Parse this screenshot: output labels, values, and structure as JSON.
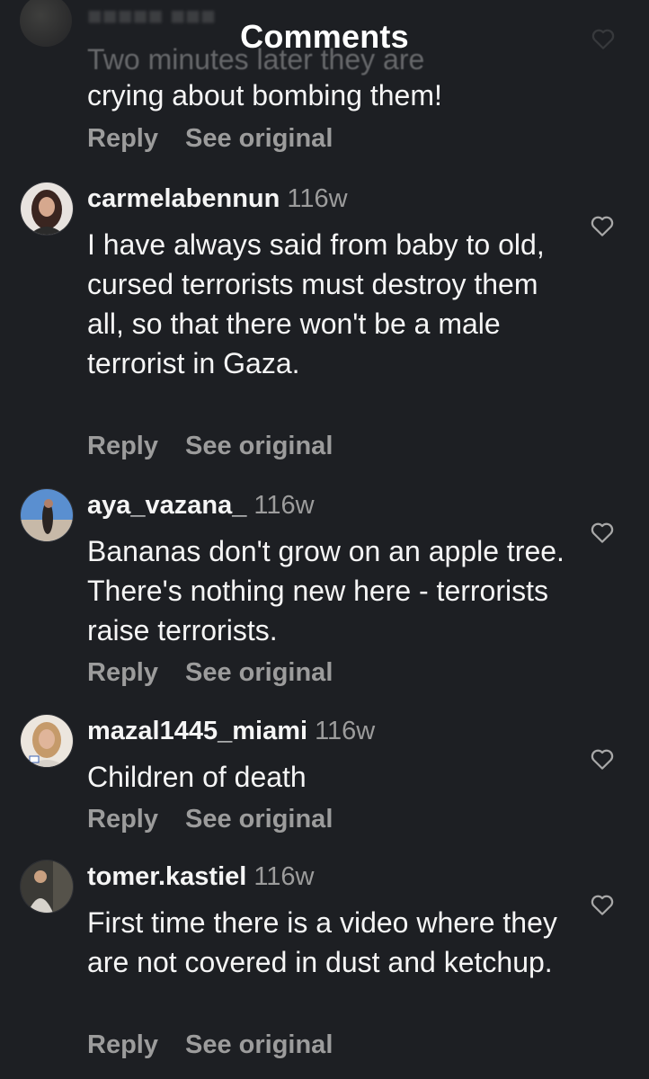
{
  "header": {
    "title": "Comments"
  },
  "partial_comment": {
    "faded_text": "Two minutes later they are",
    "text": "crying about bombing them!",
    "reply_label": "Reply",
    "see_original_label": "See original"
  },
  "comments": [
    {
      "username": "carmelabennun",
      "time": "116w",
      "text": "I have always said from baby to old, cursed terrorists must destroy them all, so that there won't be a male terrorist in Gaza.",
      "reply_label": "Reply",
      "see_original_label": "See original"
    },
    {
      "username": "aya_vazana_",
      "time": "116w",
      "text": "Bananas don't grow on an apple tree. There's nothing new here - terrorists raise terrorists.",
      "reply_label": "Reply",
      "see_original_label": "See original"
    },
    {
      "username": "mazal1445_miami",
      "time": "116w",
      "text": "Children of death",
      "reply_label": "Reply",
      "see_original_label": "See original"
    },
    {
      "username": "tomer.kastiel",
      "time": "116w",
      "text": "First time there is a video where they are not covered in dust and ketchup.",
      "reply_label": "Reply",
      "see_original_label": "See original"
    }
  ],
  "icons": {
    "like": "heart-outline-icon"
  },
  "colors": {
    "background": "#1d1f23",
    "text_primary": "#f5f5f5",
    "text_secondary": "#9c9c9c"
  }
}
